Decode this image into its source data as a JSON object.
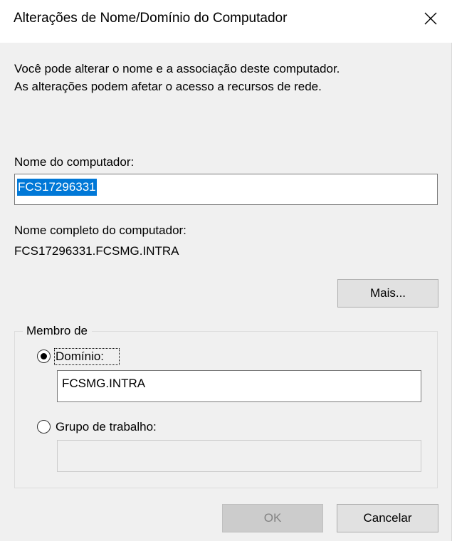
{
  "window": {
    "title": "Alterações de Nome/Domínio do Computador"
  },
  "description": {
    "line1": "Você pode alterar o nome e a associação deste computador.",
    "line2": "As alterações podem afetar o acesso a recursos de rede."
  },
  "computer_name": {
    "label": "Nome do computador:",
    "value": "FCS17296331"
  },
  "full_name": {
    "label": "Nome completo do computador:",
    "value": "FCS17296331.FCSMG.INTRA"
  },
  "more_button": {
    "label": "Mais..."
  },
  "member_of": {
    "legend": "Membro de",
    "domain": {
      "label": "Domínio:",
      "selected": true,
      "value": "FCSMG.INTRA"
    },
    "workgroup": {
      "label": "Grupo de trabalho:",
      "selected": false,
      "value": ""
    }
  },
  "buttons": {
    "ok": "OK",
    "cancel": "Cancelar"
  },
  "colors": {
    "selection": "#0078d7",
    "dialog_bg": "#f0f0f0"
  },
  "icons": {
    "close": "close-icon"
  }
}
